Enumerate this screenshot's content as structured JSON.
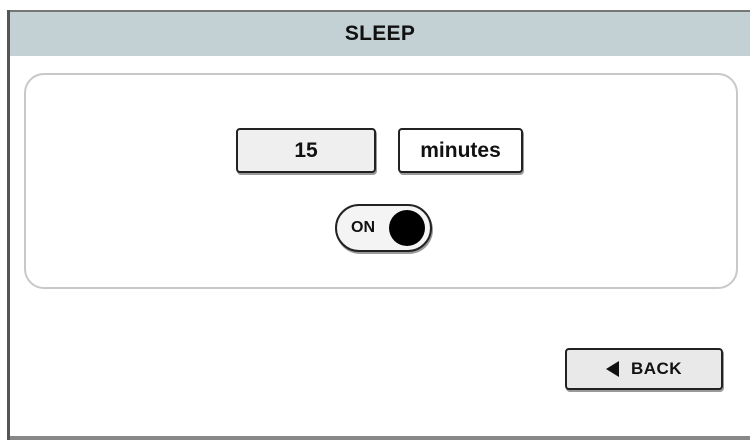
{
  "header": {
    "title": "SLEEP"
  },
  "settings": {
    "duration_value": "15",
    "duration_unit": "minutes",
    "toggle_label": "ON",
    "toggle_state": "on"
  },
  "navigation": {
    "back_label": "BACK",
    "back_icon": "back-arrow-icon"
  },
  "colors": {
    "title_bar": "#c3d1d4",
    "panel_border": "#c8c8c8",
    "toggle_knob": "#000000"
  }
}
